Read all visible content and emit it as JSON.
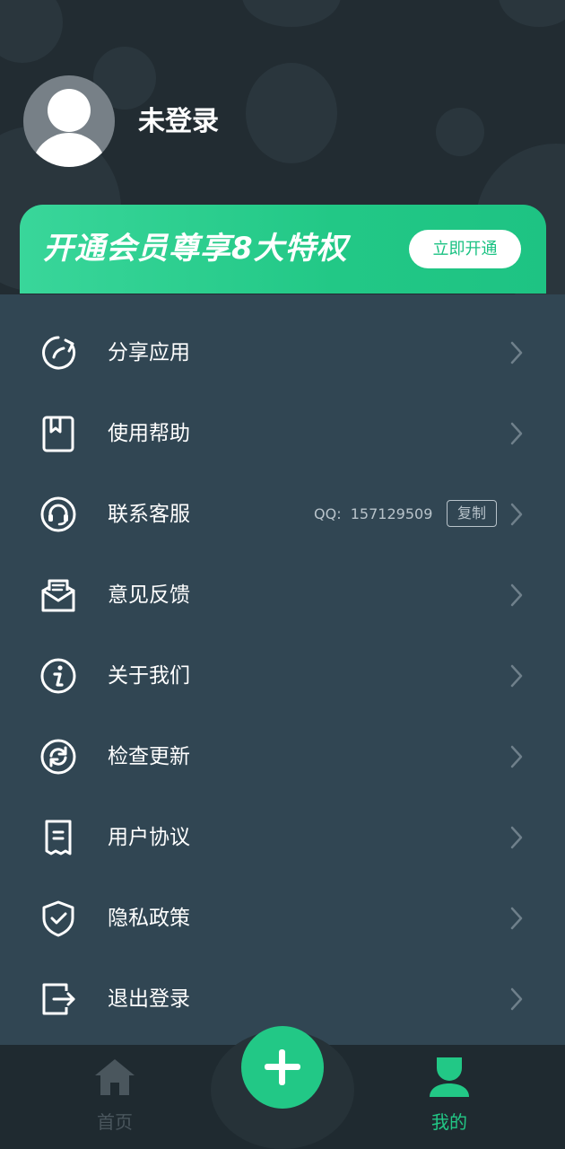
{
  "profile": {
    "username": "未登录"
  },
  "vip": {
    "title": "开通会员尊享8大特权",
    "button": "立即开通"
  },
  "menu": {
    "items": [
      {
        "label": "分享应用",
        "icon": "share-icon"
      },
      {
        "label": "使用帮助",
        "icon": "help-book-icon"
      },
      {
        "label": "联系客服",
        "icon": "headset-icon"
      },
      {
        "label": "意见反馈",
        "icon": "feedback-mail-icon"
      },
      {
        "label": "关于我们",
        "icon": "info-icon"
      },
      {
        "label": "检查更新",
        "icon": "refresh-icon"
      },
      {
        "label": "用户协议",
        "icon": "document-icon"
      },
      {
        "label": "隐私政策",
        "icon": "shield-check-icon"
      },
      {
        "label": "退出登录",
        "icon": "logout-icon"
      }
    ],
    "qq_label": "QQ:",
    "qq_number": "157129509",
    "copy_button": "复制"
  },
  "tabbar": {
    "home": "首页",
    "mine": "我的",
    "add_icon": "plus-icon"
  },
  "colors": {
    "accent": "#22c886",
    "header_bg": "#222c32",
    "menu_bg": "#314653",
    "tabbar_bg": "#1f2a30",
    "inactive_tab": "#4a565d"
  }
}
